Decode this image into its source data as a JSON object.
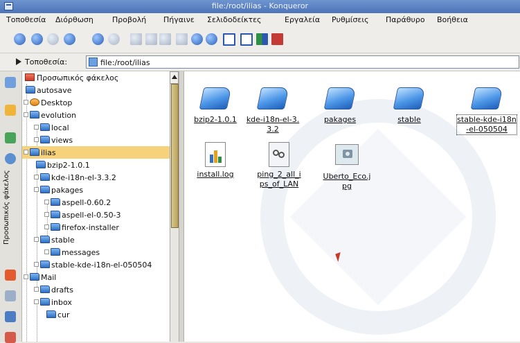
{
  "window": {
    "title": "file:/root/ilias - Konqueror"
  },
  "menu": [
    "Τοποθεσία",
    "Διόρθωση",
    "Προβολή",
    "Πήγαινε",
    "Σελιδοδείκτες",
    "Εργαλεία",
    "Ρυθμίσεις",
    "Παράθυρο",
    "Βοήθεια"
  ],
  "toolbar": [
    "up-icon",
    "back-icon",
    "forward-icon",
    "home-icon",
    "reload-icon",
    "stop-icon",
    "cut-icon",
    "copy-icon",
    "paste-icon",
    "print-icon",
    "zoom-in-icon",
    "zoom-out-icon",
    "icon-view-icon",
    "detail-view-icon",
    "tree-view-icon",
    "security-icon"
  ],
  "location": {
    "label": "Τοποθεσία:",
    "value": "file:/root/ilias"
  },
  "sidebar": {
    "vertical_label": "Προσωπικός φάκελος"
  },
  "tree": {
    "header": "Προσωπικός φάκελος",
    "items": [
      {
        "label": "autosave",
        "depth": 1
      },
      {
        "label": "Desktop",
        "depth": 1
      },
      {
        "label": "evolution",
        "depth": 1
      },
      {
        "label": "local",
        "depth": 2
      },
      {
        "label": "views",
        "depth": 2
      },
      {
        "label": "ilias",
        "depth": 1,
        "selected": true
      },
      {
        "label": "bzip2-1.0.1",
        "depth": 2
      },
      {
        "label": "kde-i18n-el-3.3.2",
        "depth": 2
      },
      {
        "label": "pakages",
        "depth": 2
      },
      {
        "label": "aspell-0.60.2",
        "depth": 3
      },
      {
        "label": "aspell-el-0.50-3",
        "depth": 3
      },
      {
        "label": "firefox-installer",
        "depth": 3
      },
      {
        "label": "stable",
        "depth": 2
      },
      {
        "label": "messages",
        "depth": 3
      },
      {
        "label": "stable-kde-i18n-el-050504",
        "depth": 2
      },
      {
        "label": "Mail",
        "depth": 1
      },
      {
        "label": "drafts",
        "depth": 2
      },
      {
        "label": "inbox",
        "depth": 2
      },
      {
        "label": "cur",
        "depth": 3
      }
    ]
  },
  "files": [
    {
      "name": "bzip2-1.0.1",
      "kind": "folder"
    },
    {
      "name": "kde-i18n-el-3.3.2",
      "kind": "folder"
    },
    {
      "name": "pakages",
      "kind": "folder"
    },
    {
      "name": "stable",
      "kind": "folder"
    },
    {
      "name": "stable-kde-i18n-el-050504",
      "kind": "folder"
    },
    {
      "name": "install.log",
      "kind": "document"
    },
    {
      "name": "ping_2_all_ips_of_LAN",
      "kind": "script"
    },
    {
      "name": "Uberto_Eco.jpg",
      "kind": "image"
    }
  ]
}
